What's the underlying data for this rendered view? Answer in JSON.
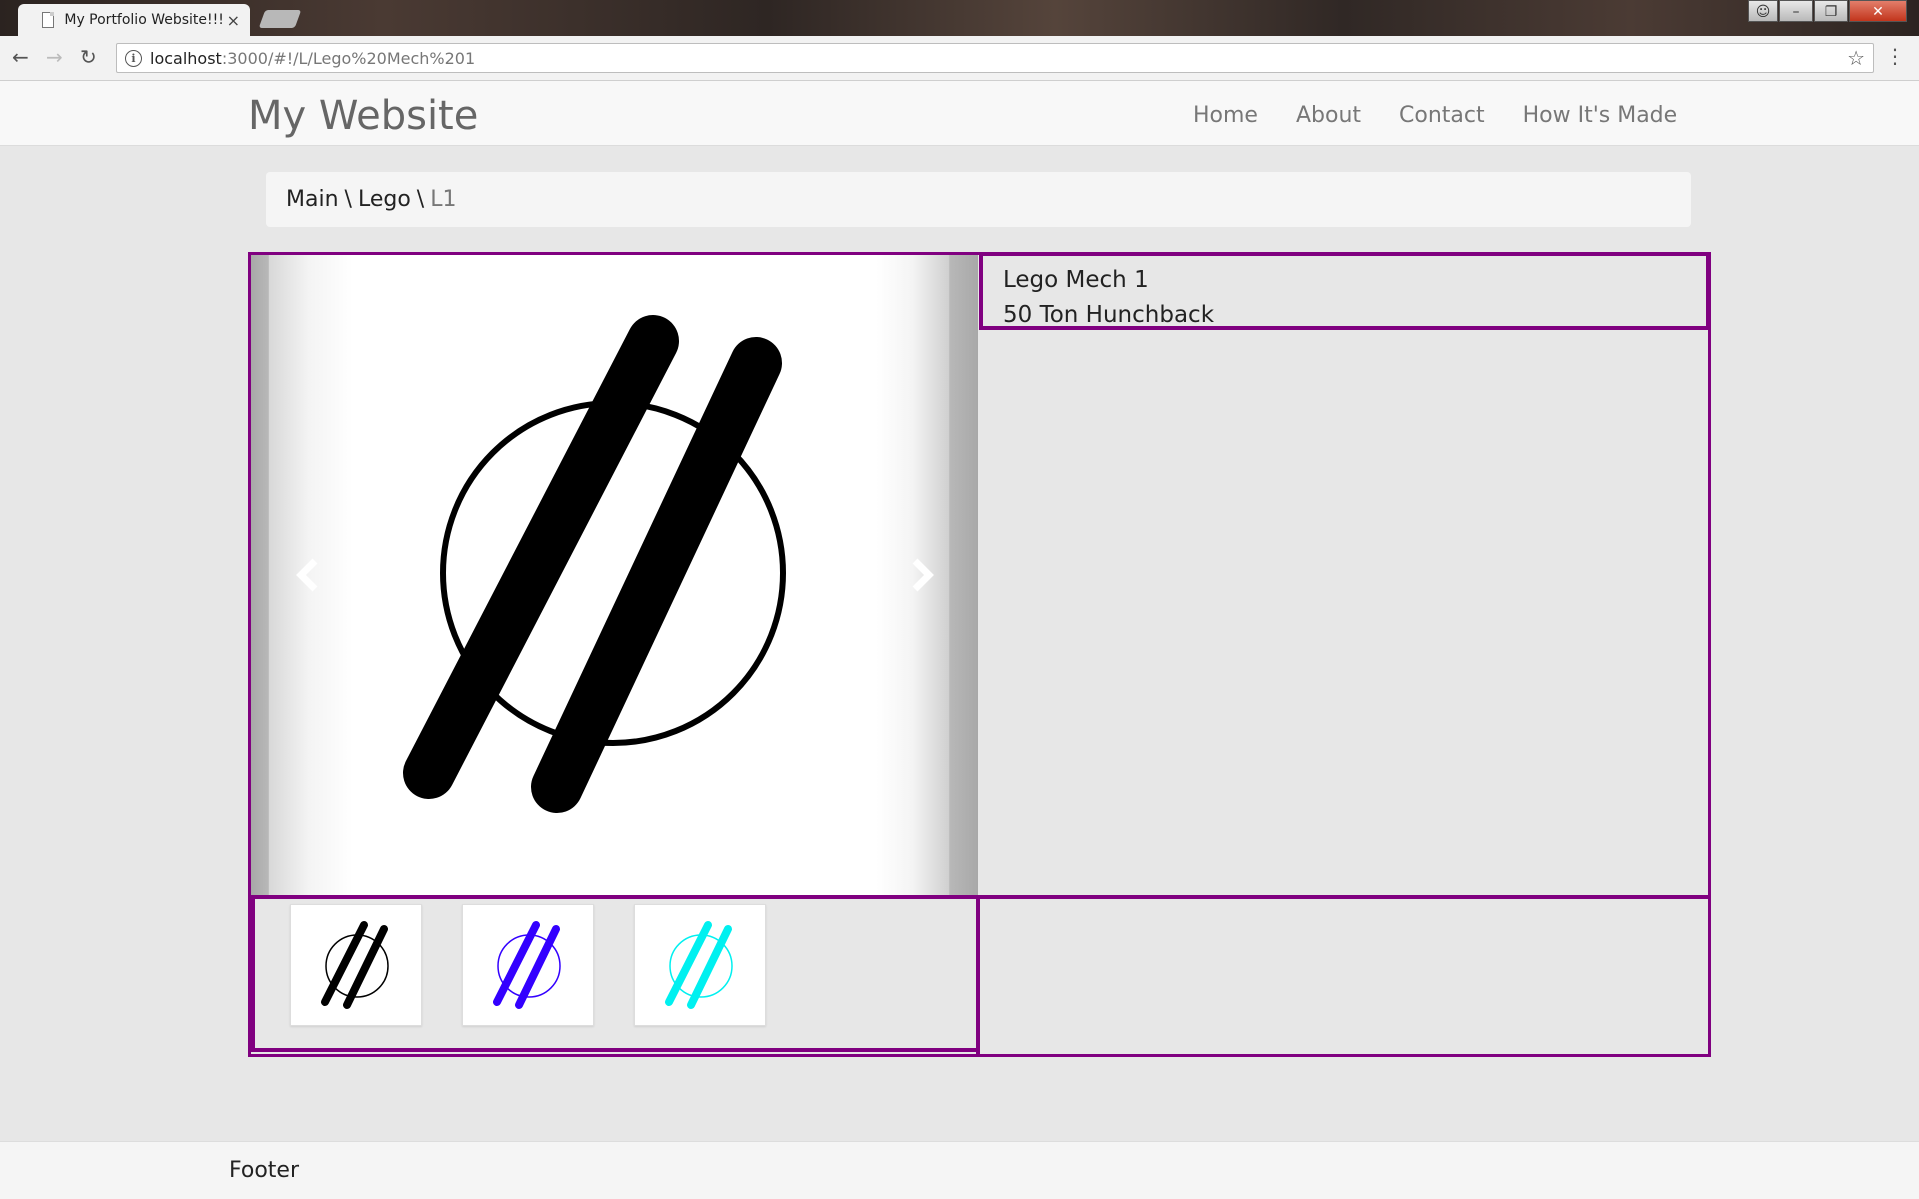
{
  "browser": {
    "tab_title": "My Portfolio Website!!!!!!",
    "url_host": "localhost",
    "url_path": ":3000/#!/L/Lego%20Mech%201",
    "controls": {
      "minimize": "–",
      "maximize": "❐",
      "close": "✕"
    }
  },
  "site": {
    "brand": "My Website",
    "nav": [
      "Home",
      "About",
      "Contact",
      "How It's Made"
    ]
  },
  "breadcrumb": {
    "items": [
      "Main",
      "Lego",
      "L1"
    ],
    "separator": "\\"
  },
  "product": {
    "title": "Lego Mech 1",
    "subtitle": "50 Ton Hunchback"
  },
  "carousel": {
    "prev_icon": "chevron-left-icon",
    "next_icon": "chevron-right-icon"
  },
  "thumbnails": [
    {
      "color": "#000000"
    },
    {
      "color": "#3300ff"
    },
    {
      "color": "#00f0f0"
    }
  ],
  "colors": {
    "frame": "#800080",
    "page_background": "#e7e7e7"
  },
  "footer": {
    "text": "Footer"
  }
}
